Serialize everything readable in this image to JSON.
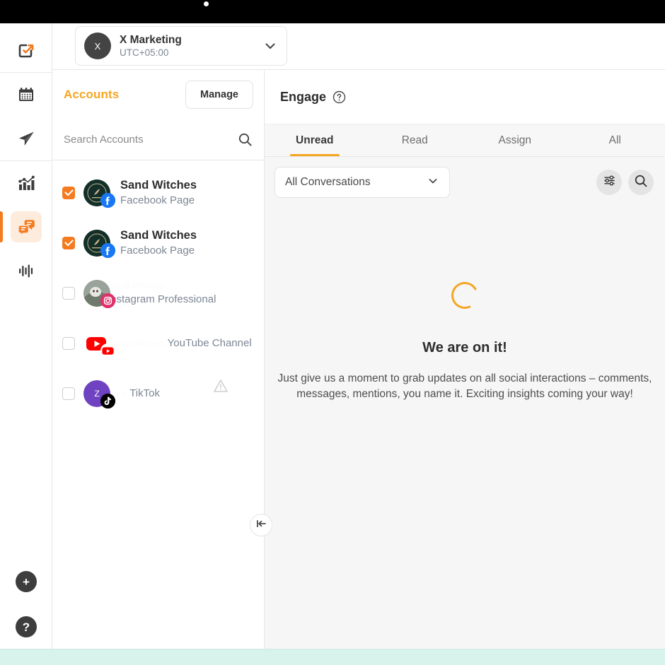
{
  "topbar": {
    "dot": "camera-dot"
  },
  "rail": {
    "items": [
      {
        "name": "tasks",
        "icon": "checkbox-arrow-icon",
        "active": false
      },
      {
        "name": "calendar",
        "icon": "calendar-icon",
        "active": false
      },
      {
        "name": "publish",
        "icon": "paper-plane-icon",
        "active": false
      },
      {
        "name": "analytics",
        "icon": "bar-chart-icon",
        "active": false
      },
      {
        "name": "engage",
        "icon": "chat-bubbles-icon",
        "active": true
      },
      {
        "name": "listening",
        "icon": "audio-wave-icon",
        "active": false
      }
    ],
    "bottom": [
      {
        "name": "add",
        "label": "+"
      },
      {
        "name": "help",
        "label": "?"
      }
    ]
  },
  "workspace": {
    "avatar_initial": "X",
    "name": "X Marketing",
    "timezone": "UTC+05:00",
    "chevron": "chevron-down-icon"
  },
  "accounts_panel": {
    "title": "Accounts",
    "manage_label": "Manage",
    "search": {
      "placeholder": "Search Accounts",
      "value": "",
      "icon": "search-icon"
    },
    "items": [
      {
        "checked": true,
        "name": "Sand Witches",
        "type": "Facebook Page",
        "network": "facebook",
        "warning": false,
        "ghost_name": ""
      },
      {
        "checked": true,
        "name": "Sand Witches",
        "type": "Facebook Page",
        "network": "facebook",
        "warning": false,
        "ghost_name": ""
      },
      {
        "checked": false,
        "name": "",
        "type": "Instagram Professional",
        "network": "instagram",
        "warning": false,
        "ghost_name": "Sand Witches"
      },
      {
        "checked": false,
        "name": "",
        "type": "YouTube Channel",
        "network": "youtube",
        "warning": false,
        "ghost_name": "Sand Witches"
      },
      {
        "checked": false,
        "name": "",
        "type": "TikTok",
        "network": "tiktok",
        "warning": true,
        "ghost_name": "Zara"
      }
    ]
  },
  "collapse_button": {
    "icon": "collapse-left-icon"
  },
  "engage": {
    "title": "Engage",
    "help_icon": "question-circle-icon",
    "tabs": [
      {
        "label": "Unread",
        "active": true
      },
      {
        "label": "Read",
        "active": false
      },
      {
        "label": "Assign",
        "active": false
      },
      {
        "label": "All",
        "active": false
      }
    ],
    "filter": {
      "selected": "All Conversations",
      "chevron": "chevron-down-icon"
    },
    "actions": [
      {
        "name": "filter-settings",
        "icon": "sliders-icon"
      },
      {
        "name": "search",
        "icon": "search-icon"
      }
    ],
    "empty_state": {
      "spinner": "loading-spinner",
      "title": "We are on it!",
      "description": "Just give us a moment to grab updates on all social interactions – comments, messages, mentions, you name it. Exciting insights coming your way!"
    }
  },
  "colors": {
    "accent_orange": "#f47b20",
    "title_orange": "#f5a623",
    "facebook": "#1877f2",
    "instagram": "#e1306c",
    "youtube": "#ff0000",
    "tiktok": "#000000",
    "panel_bg": "#f6f6f6",
    "mint_bar": "#d8f3ec"
  }
}
